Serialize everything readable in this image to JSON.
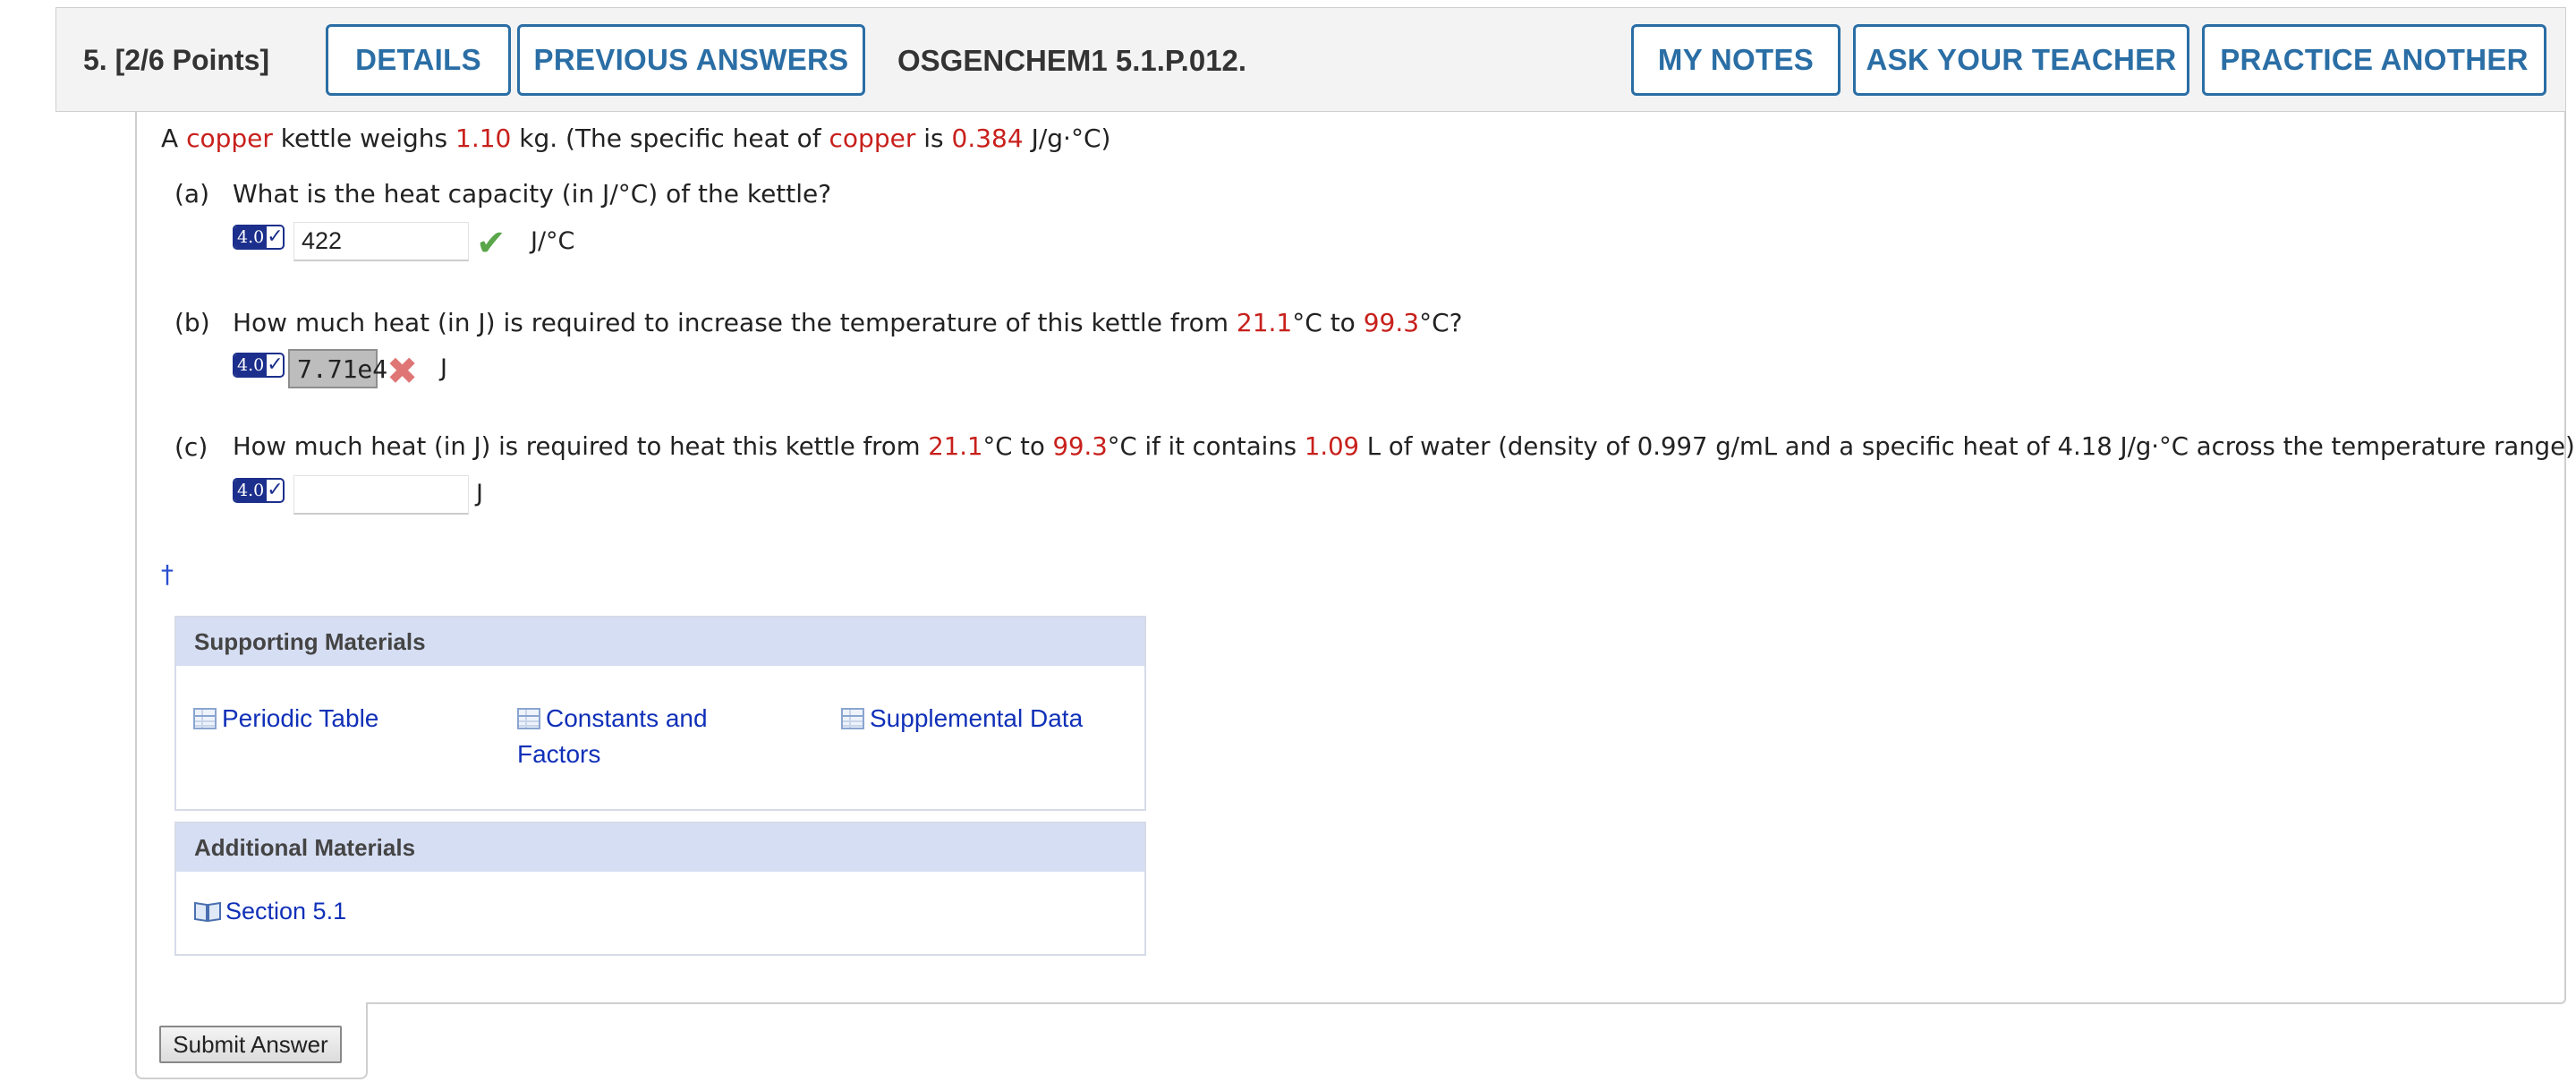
{
  "header": {
    "question_number": "5.",
    "points": "[2/6 Points]",
    "details_label": "DETAILS",
    "previous_answers_label": "PREVIOUS ANSWERS",
    "question_code": "OSGENCHEM1 5.1.P.012.",
    "my_notes_label": "MY NOTES",
    "ask_teacher_label": "ASK YOUR TEACHER",
    "practice_another_label": "PRACTICE ANOTHER"
  },
  "intro": {
    "t1": "A ",
    "metal": "copper",
    "t2": " kettle weighs ",
    "mass": "1.10",
    "t3": " kg. (The specific heat of ",
    "t4": " is ",
    "specific_heat": "0.384",
    "t5": " J/g·°C)"
  },
  "part_a": {
    "label": "(a)",
    "question": "What is the heat capacity (in J/°C) of the kettle?",
    "badge_version": "4.0",
    "answer_value": "422",
    "unit": "J/°C",
    "status_icon": "check-icon"
  },
  "part_b": {
    "label": "(b)",
    "q1": "How much heat (in J) is required to increase the temperature of this kettle from ",
    "t_start": "21.1",
    "q2": "°C to ",
    "t_end": "99.3",
    "q3": "°C?",
    "badge_version": "4.0",
    "answer_value": "7.71e4",
    "unit": "J",
    "status_icon": "x-icon"
  },
  "part_c": {
    "label": "(c)",
    "q1": "How much heat (in J) is required to heat this kettle from ",
    "t_start": "21.1",
    "q2": "°C to ",
    "t_end": "99.3",
    "q3": "°C if it contains ",
    "volume": "1.09",
    "q4": " L of water (density of 0.997 g/mL and a specific heat of 4.18 J/g·°C across the temperature range)?",
    "badge_version": "4.0",
    "answer_value": "",
    "unit": "J"
  },
  "dagger": "†",
  "supporting": {
    "title": "Supporting Materials",
    "links": [
      "Periodic Table",
      "Constants and",
      "Factors",
      "Supplemental Data"
    ]
  },
  "additional": {
    "title": "Additional Materials",
    "links": [
      "Section 5.1"
    ]
  },
  "submit_label": "Submit Answer",
  "colors": {
    "accent_blue": "#2a6ea5",
    "highlight_red": "#c8201c",
    "link_blue": "#1030b8",
    "correct_green": "#5aa64a",
    "wrong_red": "#e07575"
  }
}
